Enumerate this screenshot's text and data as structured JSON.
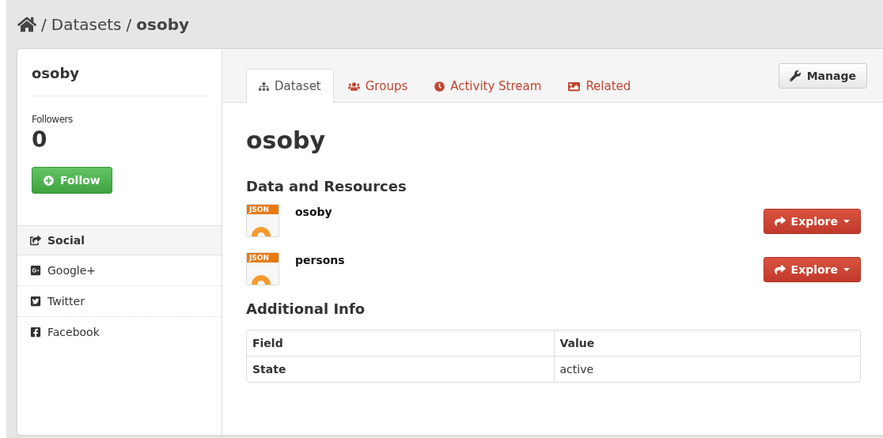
{
  "breadcrumb": [
    {
      "separator": "/",
      "label": "Datasets",
      "current": false
    },
    {
      "separator": "/",
      "label": "osoby",
      "current": true
    }
  ],
  "sidebar": {
    "title": "osoby",
    "followers_label": "Followers",
    "followers_count": "0",
    "follow_button": "Follow",
    "social": {
      "heading": "Social",
      "items": [
        {
          "kind": "googleplus",
          "label": "Google+"
        },
        {
          "kind": "twitter",
          "label": "Twitter"
        },
        {
          "kind": "facebook",
          "label": "Facebook"
        }
      ]
    }
  },
  "tabs": [
    {
      "kind": "dataset",
      "label": "Dataset",
      "selected": true
    },
    {
      "kind": "groups",
      "label": "Groups",
      "selected": false
    },
    {
      "kind": "activity",
      "label": "Activity Stream",
      "selected": false
    },
    {
      "kind": "related",
      "label": "Related",
      "selected": false
    }
  ],
  "manage_button": "Manage",
  "dataset": {
    "title": "osoby",
    "resources_heading": "Data and Resources",
    "resources": [
      {
        "format": "JSON",
        "name": "osoby",
        "action": "Explore"
      },
      {
        "format": "JSON",
        "name": "persons",
        "action": "Explore"
      }
    ],
    "info_heading": "Additional Info",
    "info_table": {
      "columns": [
        "Field",
        "Value"
      ],
      "rows": [
        [
          "State",
          "active"
        ]
      ]
    }
  }
}
